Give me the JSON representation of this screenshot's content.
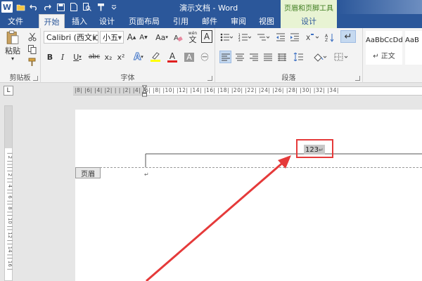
{
  "title_bar": {
    "document_title": "演示文档 - Word",
    "context_tool_title": "页眉和页脚工具",
    "logo_icon": "word-logo-icon",
    "logo_letter": "W"
  },
  "quick_access": [
    "save-icon",
    "undo-icon",
    "redo-icon",
    "new-document-icon",
    "open-icon",
    "print-preview-icon",
    "format-painter-icon",
    "customize-qat-icon"
  ],
  "tabs": [
    {
      "label": "文件",
      "kind": "file"
    },
    {
      "label": "开始",
      "kind": "active"
    },
    {
      "label": "插入",
      "kind": "normal"
    },
    {
      "label": "设计",
      "kind": "normal"
    },
    {
      "label": "页面布局",
      "kind": "normal"
    },
    {
      "label": "引用",
      "kind": "normal"
    },
    {
      "label": "邮件",
      "kind": "normal"
    },
    {
      "label": "审阅",
      "kind": "normal"
    },
    {
      "label": "视图",
      "kind": "normal"
    },
    {
      "label": "设计",
      "kind": "context"
    }
  ],
  "ribbon": {
    "clipboard": {
      "label": "剪贴板",
      "paste_label": "粘贴",
      "paste_arrow": "▾",
      "buttons": [
        "cut-icon",
        "copy-icon",
        "format-painter-icon"
      ]
    },
    "font": {
      "label": "字体",
      "font_name": "Calibri (西文に",
      "font_size": "小五",
      "grow_font": "A",
      "shrink_font": "A",
      "change_case": "Aa",
      "clear_formatting_icon": "clear-formatting-icon",
      "phonetic": "wén",
      "char_border": "A",
      "bold": "B",
      "italic": "I",
      "underline": "U",
      "strikethrough": "abc",
      "subscript": "x₂",
      "superscript": "x²",
      "text_effects": "A",
      "highlight_icon": "highlight-icon",
      "font_color": "A",
      "char_shading": "A",
      "enclosed_char": "㊀",
      "font_color_hex": "#e02020",
      "highlight_hex": "#ffff00"
    },
    "paragraph": {
      "label": "段落",
      "buttons": [
        "bullets-icon",
        "numbering-icon",
        "multilevel-list-icon",
        "decrease-indent-icon",
        "increase-indent-icon",
        "chinese-layout-icon",
        "sort-icon",
        "show-marks-icon",
        "align-left-icon",
        "center-icon",
        "align-right-icon",
        "justify-icon",
        "distributed-icon",
        "line-spacing-icon",
        "shading-icon",
        "borders-icon"
      ]
    },
    "styles": {
      "items": [
        {
          "preview": "AaBbCcDd",
          "name": "↵ 正文"
        },
        {
          "preview": "AaB",
          "name": ""
        }
      ]
    }
  },
  "ruler": {
    "horizontal_marks": "|8| |6| |4| |2| | | |2| |4| |6| |8| |10| |12| |14| |16| |18| |20| |22| |24| |26| |28| |30| |32| |34|",
    "vertical_marks": "| 2 | | | | 2 | | 4 | | 6 | | 8 | | 10 | | 12 | | 14 | | 16 |",
    "corner_symbol": "L"
  },
  "document": {
    "header_tag": "页眉",
    "header_text": "123",
    "header_return_mark": "↵",
    "paragraph_mark": "↵"
  },
  "annotation": {
    "highlight_color": "#e53a3a"
  }
}
